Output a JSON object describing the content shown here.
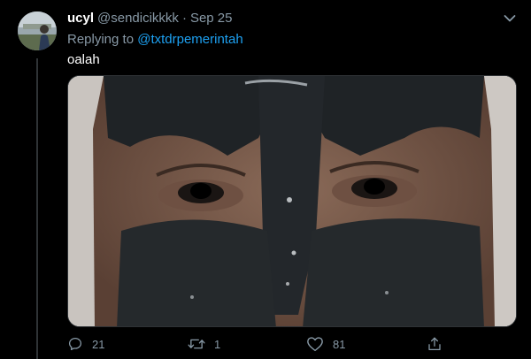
{
  "tweet": {
    "display_name": "ucyl",
    "handle": "@sendicikkkk",
    "separator": "·",
    "date": "Sep 25",
    "reply_label": "Replying to",
    "reply_mention": "@txtdrpemerintah",
    "text": "oalah",
    "media_alt": "close-up photo of a face wearing a black peel-off mask"
  },
  "actions": {
    "reply_count": "21",
    "retweet_count": "1",
    "like_count": "81"
  },
  "icons": {
    "reply": "reply-icon",
    "retweet": "retweet-icon",
    "like": "heart-icon",
    "share": "share-icon",
    "more": "chevron-down-icon"
  },
  "colors": {
    "background": "#000000",
    "name": "#ffffff",
    "secondary": "#8899a6",
    "link": "#1da1f2",
    "divider": "#2f3336"
  }
}
